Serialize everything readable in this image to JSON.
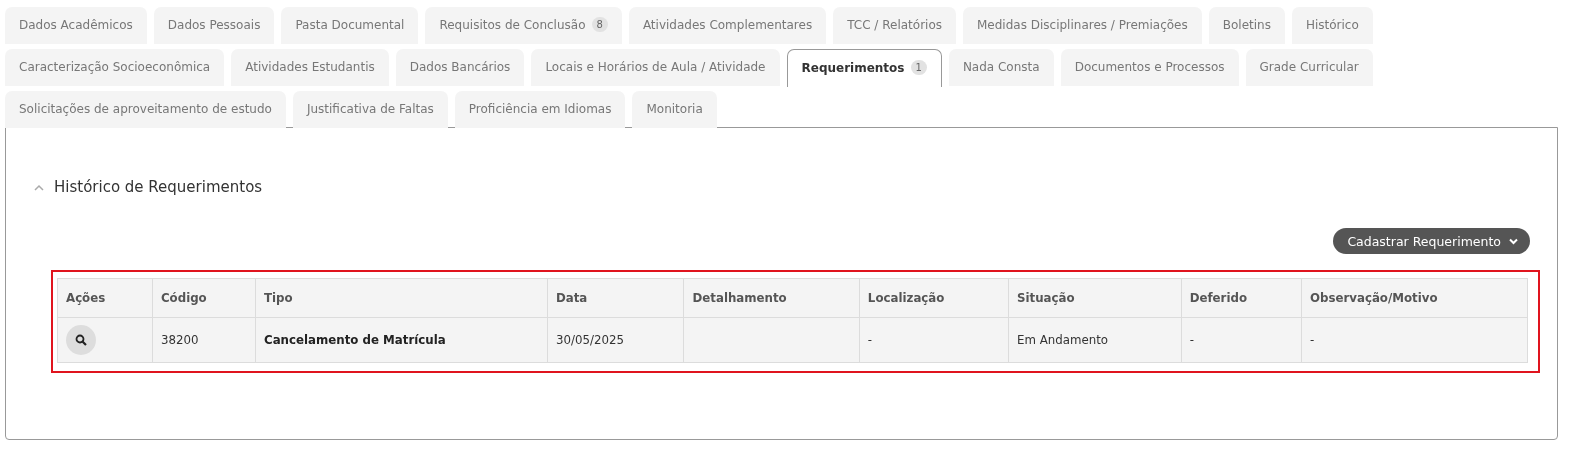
{
  "tab_rows": [
    [
      {
        "label": "Dados Acadêmicos",
        "selected": false
      },
      {
        "label": "Dados Pessoais",
        "selected": false
      },
      {
        "label": "Pasta Documental",
        "selected": false
      },
      {
        "label": "Requisitos de Conclusão",
        "badge": "8",
        "selected": false
      },
      {
        "label": "Atividades Complementares",
        "selected": false
      },
      {
        "label": "TCC / Relatórios",
        "selected": false
      },
      {
        "label": "Medidas Disciplinares / Premiações",
        "selected": false
      },
      {
        "label": "Boletins",
        "selected": false
      },
      {
        "label": "Histórico",
        "selected": false
      }
    ],
    [
      {
        "label": "Caracterização Socioeconômica",
        "selected": false
      },
      {
        "label": "Atividades Estudantis",
        "selected": false
      },
      {
        "label": "Dados Bancários",
        "selected": false
      },
      {
        "label": "Locais e Horários de Aula / Atividade",
        "selected": false
      },
      {
        "label": "Requerimentos",
        "badge": "1",
        "selected": true
      },
      {
        "label": "Nada Consta",
        "selected": false
      },
      {
        "label": "Documentos e Processos",
        "selected": false
      },
      {
        "label": "Grade Curricular",
        "selected": false
      }
    ],
    [
      {
        "label": "Solicitações de aproveitamento de estudo",
        "selected": false
      },
      {
        "label": "Justificativa de Faltas",
        "selected": false
      },
      {
        "label": "Proficiência em Idiomas",
        "selected": false
      },
      {
        "label": "Monitoria",
        "selected": false
      }
    ]
  ],
  "section": {
    "title": "Histórico de Requerimentos",
    "expanded": true,
    "action_button": {
      "label": "Cadastrar Requerimento"
    },
    "table": {
      "highlighted": true,
      "columns": [
        "Ações",
        "Código",
        "Tipo",
        "Data",
        "Detalhamento",
        "Localização",
        "Situação",
        "Deferido",
        "Observação/Motivo"
      ],
      "rows": [
        [
          {
            "kind": "action"
          },
          {
            "kind": "text",
            "text": "38200"
          },
          {
            "kind": "strong",
            "text": "Cancelamento de Matrícula"
          },
          {
            "kind": "text",
            "text": "30/05/2025"
          },
          {
            "kind": "empty"
          },
          {
            "kind": "text",
            "text": "-"
          },
          {
            "kind": "text",
            "text": "Em Andamento"
          },
          {
            "kind": "text",
            "text": "-"
          },
          {
            "kind": "text",
            "text": "-"
          }
        ]
      ]
    }
  }
}
